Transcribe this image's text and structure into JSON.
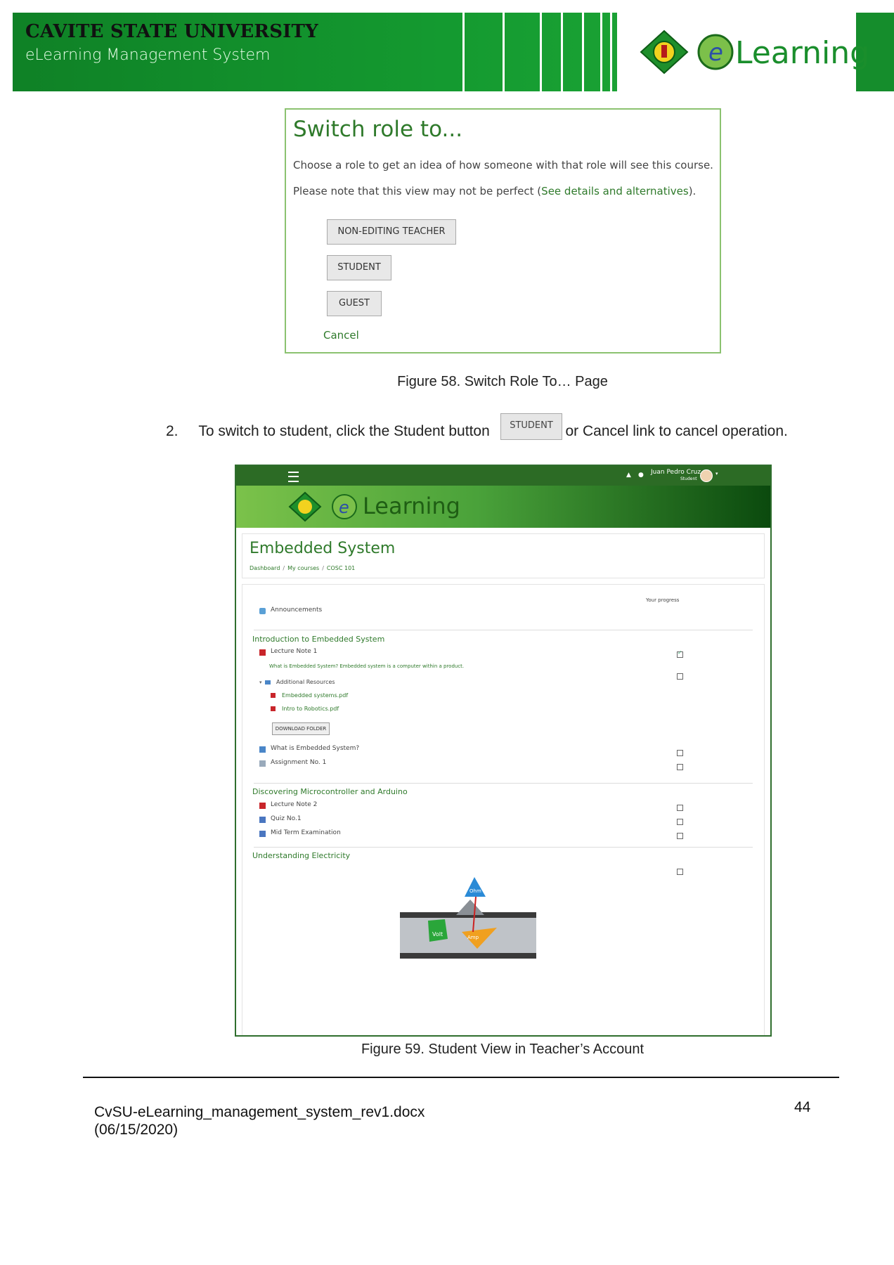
{
  "header": {
    "university": "CAVITE STATE UNIVERSITY",
    "subtitle": "eLearning Management System",
    "logo_text": "Learning",
    "logo_icon": "cvsu-seal-icon"
  },
  "figure58": {
    "title": "Switch role to...",
    "line1": "Choose a role to get an idea of how someone with that role will see this course.",
    "line2_pre": "Please note that this view may not be perfect (",
    "line2_link": "See details and alternatives",
    "line2_post": ").",
    "buttons": [
      "NON-EDITING TEACHER",
      "STUDENT",
      "GUEST"
    ],
    "cancel": "Cancel",
    "caption": "Figure 58. Switch Role To… Page"
  },
  "step": {
    "number": "2.",
    "pre": "To switch to student, click the",
    "bold1": "Student",
    "mid": "button",
    "button_label": "STUDENT",
    "or": "or",
    "bold2": "Cancel",
    "post": "link to cancel operation."
  },
  "figure59": {
    "user_name": "Juan Pedro Cruz",
    "user_role": "Student",
    "hero_logo_text": "Learning",
    "course_title": "Embedded System",
    "breadcrumbs": [
      "Dashboard",
      "My courses",
      "COSC 101"
    ],
    "progress_label": "Your progress",
    "announcements": "Announcements",
    "sections": [
      {
        "title": "Introduction to Embedded System",
        "items": [
          "Lecture Note 1",
          "Additional Resources",
          "Embedded systems.pdf",
          "Intro to Robotics.pdf",
          "What is Embedded System?",
          "Assignment No. 1"
        ],
        "description": "What is Embedded System? Embedded system is a computer within a product.",
        "download_button": "DOWNLOAD FOLDER"
      },
      {
        "title": "Discovering Microcontroller and Arduino",
        "items": [
          "Lecture Note 2",
          "Quiz No.1",
          "Mid Term Examination"
        ]
      },
      {
        "title": "Understanding Electricity",
        "items": []
      }
    ],
    "illustration_labels": [
      "Ohm",
      "Volt",
      "Amp"
    ],
    "caption": "Figure 59. Student View in Teacher’s Account"
  },
  "footer": {
    "filename": "CvSU-eLearning_management_system_rev1.docx",
    "date": "(06/15/2020)",
    "page_number": "44"
  }
}
